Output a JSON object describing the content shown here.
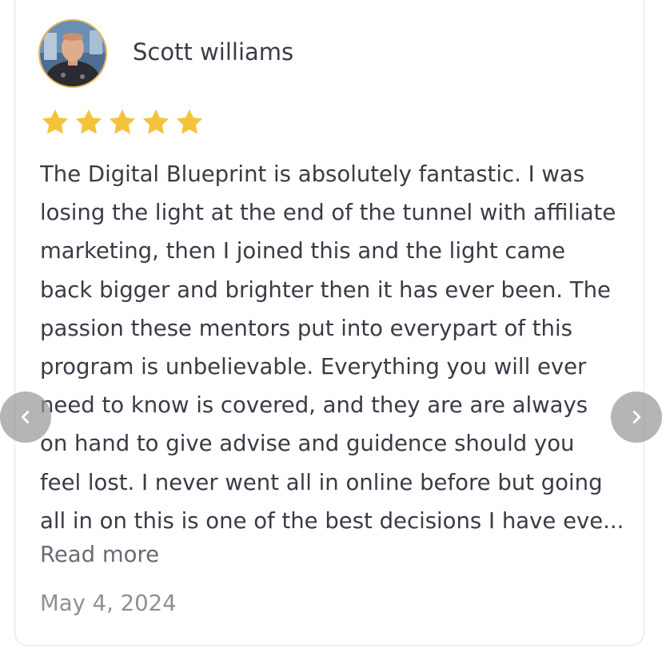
{
  "review": {
    "author_name": "Scott williams",
    "rating": 5,
    "rating_max": 5,
    "text_lines": [
      "The Digital Blueprint is absolutely fantastic. I was",
      "losing the light at the end of the tunnel with affiliate",
      "marketing, then I joined this and the light came",
      "back bigger and brighter then it has ever been. The",
      "passion these mentors put into everypart of this",
      "program is unbelievable. Everything you will ever",
      "need to know is covered, and they are are always",
      "on hand to give advise and guidence should you",
      "feel lost. I never went all in online before but going",
      "all in on this is one of the best decisions I have eve..."
    ],
    "read_more_label": "Read more",
    "date": "May 4, 2024"
  },
  "icons": {
    "prev": "chevron-left-icon",
    "next": "chevron-right-icon",
    "star": "star-icon"
  },
  "colors": {
    "star": "#f5c33b",
    "nav_button": "#999999",
    "text": "#3a3b46",
    "muted": "#8e8f97"
  }
}
